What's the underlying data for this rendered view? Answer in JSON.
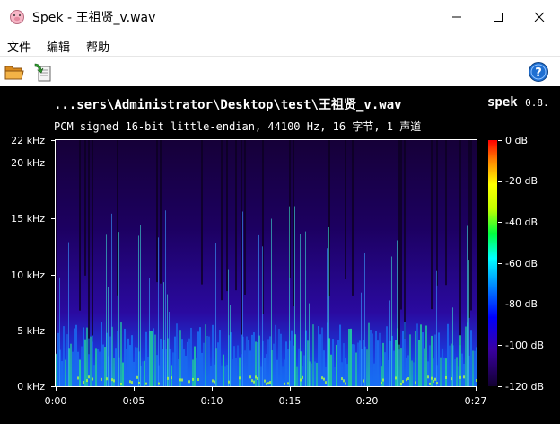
{
  "window": {
    "title": "Spek - 王祖贤_v.wav",
    "icon": "pig-face-icon",
    "controls": [
      "minimize-icon",
      "maximize-icon",
      "close-icon"
    ]
  },
  "menu": {
    "file": "文件",
    "edit": "编辑",
    "help": "帮助"
  },
  "toolbar": {
    "open_icon": "folder-open-icon",
    "save_icon": "save-arrow-icon",
    "help_icon": "question-circle-icon"
  },
  "spectrogram": {
    "file_path": "...sers\\Administrator\\Desktop\\test\\王祖贤_v.wav",
    "app_name": "spek",
    "version": "0.8.",
    "file_info": "PCM signed 16-bit little-endian, 44100 Hz, 16 字节, 1 声道",
    "y_ticks": [
      "22 kHz",
      "20 kHz",
      "15 kHz",
      "10 kHz",
      "5 kHz",
      "0 kHz"
    ],
    "x_ticks": [
      "0:00",
      "0:05",
      "0:10",
      "0:15",
      "0:20",
      "0:27"
    ],
    "db_ticks": [
      "0 dB",
      "-20 dB",
      "-40 dB",
      "-60 dB",
      "-80 dB",
      "-100 dB",
      "-120 dB"
    ]
  },
  "chart_data": {
    "type": "heatmap",
    "xlabel": "",
    "ylabel": "",
    "xlim": [
      0,
      27
    ],
    "ylim": [
      0,
      22
    ],
    "x_ticks_seconds": [
      0,
      5,
      10,
      15,
      20,
      27
    ],
    "y_ticks_khz": [
      22,
      20,
      15,
      10,
      5,
      0
    ],
    "colorbar_db": [
      0,
      -20,
      -40,
      -60,
      -80,
      -100,
      -120
    ]
  }
}
